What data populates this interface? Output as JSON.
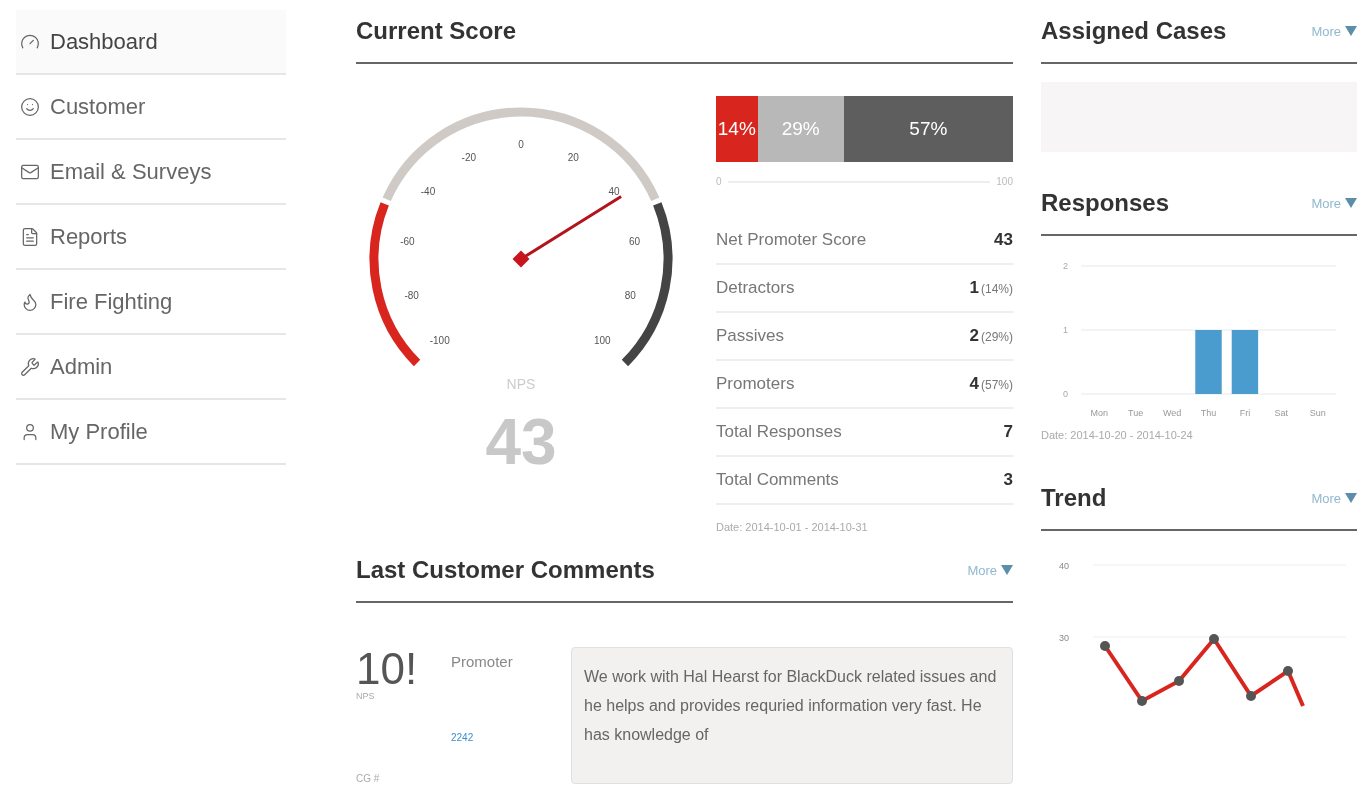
{
  "sidebar": {
    "items": [
      {
        "label": "Dashboard",
        "selected": true
      },
      {
        "label": "Customer",
        "selected": false
      },
      {
        "label": "Email & Surveys",
        "selected": false
      },
      {
        "label": "Reports",
        "selected": false
      },
      {
        "label": "Fire Fighting",
        "selected": false
      },
      {
        "label": "Admin",
        "selected": false
      },
      {
        "label": "My Profile",
        "selected": false
      }
    ]
  },
  "current_score": {
    "title": "Current Score",
    "gauge": {
      "level": 0.715,
      "ticks": [
        "-100",
        "-80",
        "-60",
        "-40",
        "-20",
        "0",
        "20",
        "40",
        "60",
        "80",
        "100"
      ],
      "caption": "NPS",
      "score": "43"
    },
    "breakdown": [
      {
        "kind": "detractor",
        "label": "14%",
        "level": 0.14
      },
      {
        "kind": "passive",
        "label": "29%",
        "level": 0.29
      },
      {
        "kind": "promoter",
        "label": "57%",
        "level": 0.57
      }
    ],
    "scale": {
      "min": "0",
      "max": "100"
    },
    "stats": [
      {
        "label": "Net Promoter Score",
        "value": "43"
      },
      {
        "label": "Detractors",
        "value": "1",
        "share": "(14%)"
      },
      {
        "label": "Passives",
        "value": "2",
        "share": "(29%)"
      },
      {
        "label": "Promoters",
        "value": "4",
        "share": "(57%)"
      },
      {
        "label": "Total Responses",
        "value": "7"
      },
      {
        "label": "Total Comments",
        "value": "3"
      }
    ],
    "date": "Date: 2014-10-01 - 2014-10-31"
  },
  "comments": {
    "title": "Last Customer Comments",
    "more": "More",
    "items": [
      {
        "score": "10!",
        "score_caption": "NPS",
        "category": "Promoter",
        "case_label": "CG #",
        "case_number": "2242",
        "text": "We work with Hal Hearst for BlackDuck related issues and he helps and provides requried information very fast. He has knowledge of"
      }
    ]
  },
  "assigned_cases": {
    "title": "Assigned Cases",
    "more": "More"
  },
  "responses": {
    "title": "Responses",
    "more": "More",
    "date": "Date: 2014-10-20 - 2014-10-24",
    "chart_data": {
      "type": "bar",
      "categories": [
        "Mon",
        "Tue",
        "Wed",
        "Thu",
        "Fri",
        "Sat",
        "Sun"
      ],
      "values": [
        0,
        0,
        0,
        1,
        1,
        0,
        0
      ],
      "yticks": [
        0,
        1,
        2
      ],
      "ylim": [
        0,
        2
      ]
    }
  },
  "trend": {
    "title": "Trend",
    "more": "More",
    "axis_labels": [
      "40",
      "30"
    ]
  }
}
